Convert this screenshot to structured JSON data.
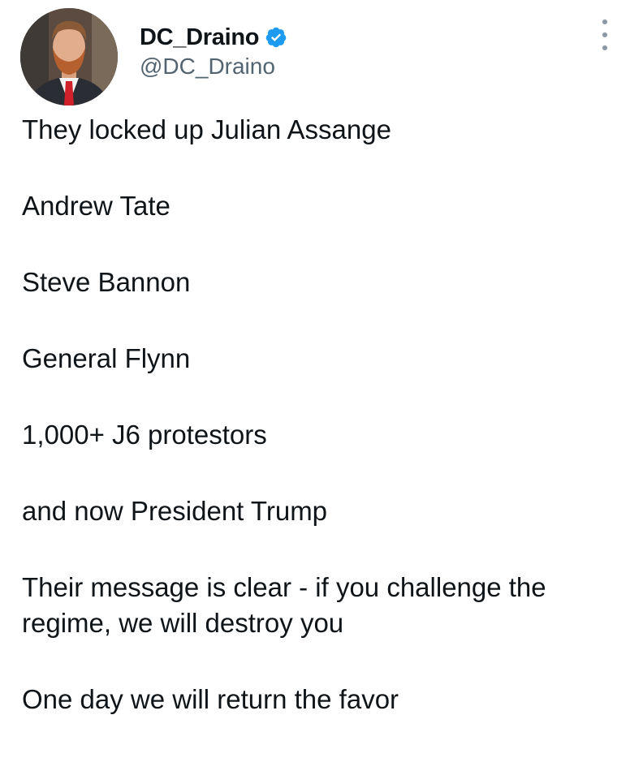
{
  "author": {
    "display_name": "DC_Draino",
    "handle": "@DC_Draino",
    "verified": true,
    "verified_color": "#1d9bf0"
  },
  "menu": {
    "icon": "more-vertical-icon"
  },
  "tweet": {
    "paragraphs": [
      "They locked up Julian Assange",
      "Andrew Tate",
      "Steve Bannon",
      "General Flynn",
      "1,000+ J6 protestors",
      "and now President Trump",
      "Their message is clear - if you challenge the regime, we will destroy you",
      "One day we will return the favor"
    ]
  }
}
